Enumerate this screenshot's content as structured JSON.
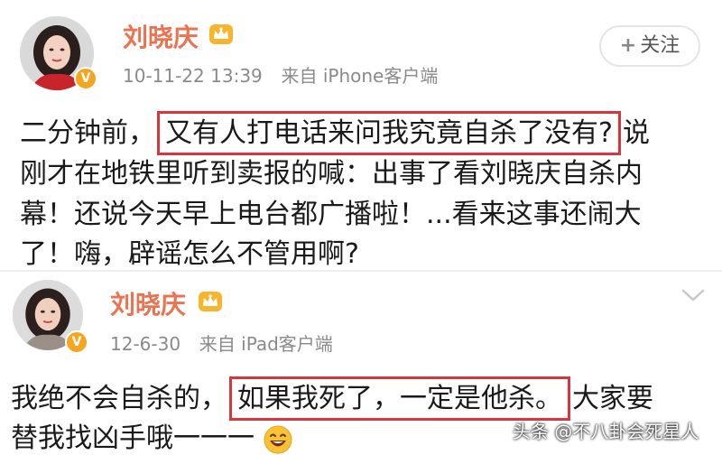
{
  "posts": [
    {
      "username": "刘晓庆",
      "timestamp": "10-11-22 13:39",
      "source": "来自 iPhone客户端",
      "follow_label": "关注",
      "icons": {
        "avatar": "avatar-photo",
        "verified": "verified-badge-v",
        "crown": "crown-icon",
        "follow": "plus-icon"
      },
      "body": {
        "line1_pre": "二分钟前，",
        "line1_highlight": "又有人打电话来问我究竟自杀了没有?",
        "line1_post": "说",
        "line2": "刚才在地铁里听到卖报的喊：出事了看刘晓庆自杀内",
        "line3": "幕！还说今天早上电台都广播啦！...看来这事还闹大",
        "line4": "了！嗨，辟谣怎么不管用啊?"
      }
    },
    {
      "username": "刘晓庆",
      "timestamp": "12-6-30",
      "source": "来自 iPad客户端",
      "icons": {
        "avatar": "avatar-photo",
        "verified": "verified-badge-v",
        "crown": "crown-icon",
        "menu": "chevron-down-icon",
        "emoji": "laughing-emoji"
      },
      "body": {
        "line1_pre": "我绝不会自杀的，",
        "line1_highlight": "如果我死了，一定是他杀。",
        "line1_post": "大家要",
        "line2": "替我找凶手哦一一一"
      }
    }
  ],
  "watermark": "头条 @不八卦会死星人",
  "colors": {
    "username": "#eb7350",
    "meta": "#8a8a8a",
    "highlight_box": "#d8363e",
    "verified_badge": "#f6a61e"
  }
}
